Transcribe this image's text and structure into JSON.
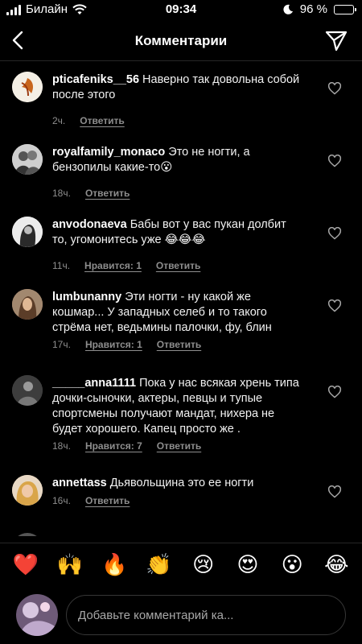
{
  "status_bar": {
    "carrier": "Билайн",
    "time": "09:34",
    "battery": "96 %",
    "battery_level": 0.96
  },
  "header": {
    "title": "Комментарии"
  },
  "comments": [
    {
      "username": "pticafeniks__56",
      "text": "Наверно так довольна собой после этого",
      "time": "2ч.",
      "likes": "",
      "reply": "Ответить"
    },
    {
      "username": "royalfamily_monaco",
      "text": "Это не ногти, а бензопилы какие-то😮",
      "time": "18ч.",
      "likes": "",
      "reply": "Ответить"
    },
    {
      "username": "anvodonaeva",
      "text": "Бабы вот у вас пукан долбит то, угомонитесь уже 😂😂😂",
      "time": "11ч.",
      "likes": "Нравится: 1",
      "reply": "Ответить"
    },
    {
      "username": "lumbunanny",
      "text": "Эти ногти - ну какой же кошмар... У западных селеб и то такого стрёма нет, ведьмины палочки, фу, блин",
      "time": "17ч.",
      "likes": "Нравится: 1",
      "reply": "Ответить"
    },
    {
      "username": "_____anna1111",
      "text": "Пока у нас всякая хрень типа дочки-сыночки, актеры, певцы и тупые спортсмены получают мандат, нихера не будет хорошего. Капец просто же .",
      "time": "18ч.",
      "likes": "Нравится: 7",
      "reply": "Ответить"
    },
    {
      "username": "annettass",
      "text": "Дьявольщина это ее ногти",
      "time": "16ч.",
      "likes": "",
      "reply": "Ответить"
    }
  ],
  "emoji_bar": [
    "❤️",
    "🙌",
    "🔥",
    "👏",
    "😢",
    "😍",
    "😮",
    "😂"
  ],
  "input": {
    "placeholder": "Добавьте комментарий ка..."
  }
}
